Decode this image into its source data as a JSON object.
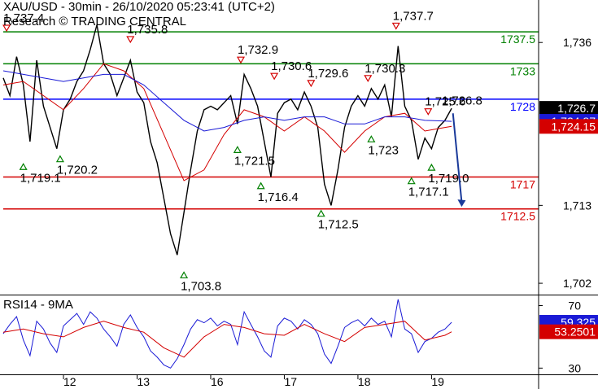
{
  "header": {
    "title": "XAU/USD - 30min - 26/10/2020 05:23:41 (UTC+2)",
    "subtitle": "Research © TRADING CENTRAL"
  },
  "colors": {
    "price": "#000000",
    "ema_fast": "#d40000",
    "ema_slow": "#1a1ad6",
    "resistance": "#008000",
    "pivot": "#0000ff",
    "support": "#d40000",
    "last_price_box": "#000000",
    "blue_box": "#1a1ad6",
    "red_box": "#d40000",
    "arrow": "#1a3a9a",
    "marker_up": "#008000",
    "marker_down": "#d40000"
  },
  "chart_data": [
    {
      "type": "line",
      "title": "XAU/USD - 30min",
      "y_axis_side": "right",
      "ylim": [
        1700.4,
        1742.0
      ],
      "y_ticks": [
        1702,
        1713,
        1736
      ],
      "x_ticks": [
        {
          "label": "12",
          "x": 0.9
        },
        {
          "label": "13",
          "x": 2.0
        },
        {
          "label": "16",
          "x": 3.1
        },
        {
          "label": "17",
          "x": 4.2
        },
        {
          "label": "18",
          "x": 5.3
        },
        {
          "label": "19",
          "x": 6.4
        }
      ],
      "xlim": [
        0,
        8.0
      ],
      "grid": false,
      "levels": [
        {
          "label": "1737.5",
          "value": 1737.5,
          "role": "resistance"
        },
        {
          "label": "1733",
          "value": 1733.0,
          "role": "resistance"
        },
        {
          "label": "1728",
          "value": 1728.0,
          "role": "pivot"
        },
        {
          "label": "1717",
          "value": 1717.0,
          "role": "support"
        },
        {
          "label": "1712.5",
          "value": 1712.5,
          "role": "support"
        }
      ],
      "price_boxes": [
        {
          "label": "1,726.7",
          "value": 1726.7,
          "style": "last_price_box"
        },
        {
          "label": "1,724.87",
          "value": 1724.87,
          "style": "blue_box"
        },
        {
          "label": "1,724.15",
          "value": 1724.15,
          "style": "red_box"
        }
      ],
      "annotations": [
        {
          "label": "1,737.4",
          "x": 0.05,
          "y": 1737.4,
          "marker": "down"
        },
        {
          "label": "1,735.8",
          "x": 1.9,
          "y": 1735.8,
          "marker": "down"
        },
        {
          "label": "1,732.9",
          "x": 3.55,
          "y": 1732.9,
          "marker": "down"
        },
        {
          "label": "1,730.6",
          "x": 4.05,
          "y": 1730.6,
          "marker": "down"
        },
        {
          "label": "1,729.6",
          "x": 4.6,
          "y": 1729.6,
          "marker": "down"
        },
        {
          "label": "1,730.3",
          "x": 5.45,
          "y": 1730.3,
          "marker": "down"
        },
        {
          "label": "1,737.7",
          "x": 5.87,
          "y": 1737.7,
          "marker": "down"
        },
        {
          "label": "1,725.6",
          "x": 6.35,
          "y": 1725.6,
          "marker": "down"
        },
        {
          "label": "1,726.8",
          "x": 6.6,
          "y": 1726.8,
          "marker": "none"
        },
        {
          "label": "1,719.1",
          "x": 0.3,
          "y": 1719.1,
          "marker": "up"
        },
        {
          "label": "1,720.2",
          "x": 0.85,
          "y": 1720.2,
          "marker": "up"
        },
        {
          "label": "1,721.5",
          "x": 3.5,
          "y": 1721.5,
          "marker": "up"
        },
        {
          "label": "1,716.4",
          "x": 3.85,
          "y": 1716.4,
          "marker": "up"
        },
        {
          "label": "1,712.5",
          "x": 4.75,
          "y": 1712.5,
          "marker": "up"
        },
        {
          "label": "1,723",
          "x": 5.5,
          "y": 1723.0,
          "marker": "up"
        },
        {
          "label": "1,717.1",
          "x": 6.1,
          "y": 1717.1,
          "marker": "up"
        },
        {
          "label": "1,719.0",
          "x": 6.4,
          "y": 1719.0,
          "marker": "up"
        },
        {
          "label": "1,703.8",
          "x": 2.7,
          "y": 1703.8,
          "marker": "up"
        }
      ],
      "forecast_arrow": {
        "from": {
          "x": 6.72,
          "y": 1726.0
        },
        "to": {
          "x": 6.85,
          "y": 1712.8
        }
      },
      "series": [
        {
          "role": "price",
          "x": [
            0.0,
            0.1,
            0.2,
            0.3,
            0.4,
            0.5,
            0.6,
            0.7,
            0.8,
            0.9,
            1.0,
            1.1,
            1.2,
            1.3,
            1.4,
            1.5,
            1.6,
            1.7,
            1.8,
            1.9,
            2.0,
            2.1,
            2.2,
            2.3,
            2.4,
            2.5,
            2.6,
            2.7,
            2.8,
            2.9,
            3.0,
            3.1,
            3.2,
            3.3,
            3.4,
            3.5,
            3.6,
            3.7,
            3.8,
            3.9,
            4.0,
            4.1,
            4.2,
            4.3,
            4.4,
            4.5,
            4.6,
            4.7,
            4.8,
            4.9,
            5.0,
            5.1,
            5.2,
            5.3,
            5.4,
            5.5,
            5.6,
            5.7,
            5.8,
            5.9,
            6.0,
            6.1,
            6.2,
            6.3,
            6.4,
            6.5,
            6.6,
            6.7
          ],
          "values": [
            1731.0,
            1728.5,
            1734.0,
            1730.0,
            1722.0,
            1733.5,
            1727.0,
            1724.0,
            1721.0,
            1726.5,
            1728.0,
            1730.5,
            1732.0,
            1735.0,
            1738.5,
            1733.0,
            1731.5,
            1728.5,
            1731.0,
            1733.5,
            1729.0,
            1727.5,
            1722.0,
            1719.0,
            1714.0,
            1709.0,
            1706.0,
            1712.0,
            1718.0,
            1723.5,
            1726.5,
            1727.0,
            1726.5,
            1727.5,
            1728.5,
            1724.5,
            1731.5,
            1729.5,
            1727.0,
            1722.0,
            1717.0,
            1726.0,
            1727.5,
            1728.0,
            1726.5,
            1729.0,
            1727.0,
            1724.0,
            1716.0,
            1713.0,
            1718.0,
            1724.0,
            1727.0,
            1728.5,
            1727.0,
            1729.5,
            1728.0,
            1730.0,
            1725.5,
            1735.5,
            1727.0,
            1725.0,
            1719.5,
            1722.5,
            1721.0,
            1724.0,
            1725.0,
            1726.7
          ]
        },
        {
          "role": "ema_fast",
          "x": [
            0.0,
            0.3,
            0.6,
            0.9,
            1.2,
            1.5,
            1.8,
            2.1,
            2.4,
            2.7,
            3.0,
            3.3,
            3.6,
            3.9,
            4.2,
            4.5,
            4.8,
            5.1,
            5.4,
            5.7,
            6.0,
            6.3,
            6.6,
            6.7
          ],
          "values": [
            1730.0,
            1730.5,
            1728.5,
            1726.5,
            1729.5,
            1733.0,
            1732.0,
            1729.5,
            1723.0,
            1716.5,
            1718.0,
            1723.0,
            1726.5,
            1725.5,
            1723.5,
            1725.5,
            1723.5,
            1720.5,
            1723.5,
            1725.5,
            1726.0,
            1723.5,
            1724.0,
            1724.15
          ]
        },
        {
          "role": "ema_slow",
          "x": [
            0.0,
            0.3,
            0.6,
            0.9,
            1.2,
            1.5,
            1.8,
            2.1,
            2.4,
            2.7,
            3.0,
            3.3,
            3.6,
            3.9,
            4.2,
            4.5,
            4.8,
            5.1,
            5.4,
            5.7,
            6.0,
            6.3,
            6.6,
            6.7
          ],
          "values": [
            1732.0,
            1731.5,
            1731.0,
            1730.5,
            1731.0,
            1731.5,
            1731.5,
            1730.0,
            1727.5,
            1725.0,
            1723.5,
            1724.0,
            1725.0,
            1725.5,
            1725.0,
            1725.5,
            1725.5,
            1724.5,
            1724.5,
            1725.5,
            1725.5,
            1725.0,
            1724.9,
            1724.87
          ]
        }
      ]
    },
    {
      "type": "line",
      "title": "RSI14 - 9MA",
      "ylim": [
        26,
        76
      ],
      "y_ticks": [
        30,
        70
      ],
      "xlim": [
        0,
        8.0
      ],
      "price_boxes": [
        {
          "label": "59.325",
          "value": 59.325,
          "style": "blue_box"
        },
        {
          "label": "53.2501",
          "value": 53.2501,
          "style": "red_box"
        }
      ],
      "series": [
        {
          "role": "rsi",
          "x": [
            0.0,
            0.1,
            0.2,
            0.3,
            0.4,
            0.5,
            0.6,
            0.7,
            0.8,
            0.9,
            1.0,
            1.1,
            1.2,
            1.3,
            1.4,
            1.5,
            1.6,
            1.7,
            1.8,
            1.9,
            2.0,
            2.1,
            2.2,
            2.3,
            2.4,
            2.5,
            2.6,
            2.7,
            2.8,
            2.9,
            3.0,
            3.1,
            3.2,
            3.3,
            3.4,
            3.5,
            3.6,
            3.7,
            3.8,
            3.9,
            4.0,
            4.1,
            4.2,
            4.3,
            4.4,
            4.5,
            4.6,
            4.7,
            4.8,
            4.9,
            5.0,
            5.1,
            5.2,
            5.3,
            5.4,
            5.5,
            5.6,
            5.7,
            5.8,
            5.9,
            6.0,
            6.1,
            6.2,
            6.3,
            6.4,
            6.5,
            6.6,
            6.7
          ],
          "values": [
            52,
            58,
            63,
            48,
            38,
            60,
            55,
            46,
            40,
            57,
            61,
            65,
            58,
            66,
            62,
            55,
            50,
            44,
            58,
            64,
            56,
            50,
            41,
            37,
            32,
            30,
            36,
            45,
            55,
            61,
            59,
            62,
            57,
            60,
            58,
            45,
            66,
            58,
            50,
            41,
            37,
            57,
            62,
            60,
            55,
            61,
            58,
            52,
            39,
            33,
            44,
            56,
            59,
            61,
            57,
            62,
            58,
            60,
            50,
            74,
            55,
            52,
            40,
            47,
            49,
            53,
            55,
            59.325
          ]
        },
        {
          "role": "ma",
          "x": [
            0.0,
            0.3,
            0.6,
            0.9,
            1.2,
            1.5,
            1.8,
            2.1,
            2.4,
            2.7,
            3.0,
            3.3,
            3.6,
            3.9,
            4.2,
            4.5,
            4.8,
            5.1,
            5.4,
            5.7,
            6.0,
            6.3,
            6.6,
            6.7
          ],
          "values": [
            53,
            55,
            52,
            50,
            56,
            60,
            56,
            53,
            43,
            37,
            50,
            58,
            56,
            52,
            51,
            58,
            52,
            47,
            56,
            58,
            60,
            48,
            51,
            53.2501
          ]
        }
      ]
    }
  ]
}
